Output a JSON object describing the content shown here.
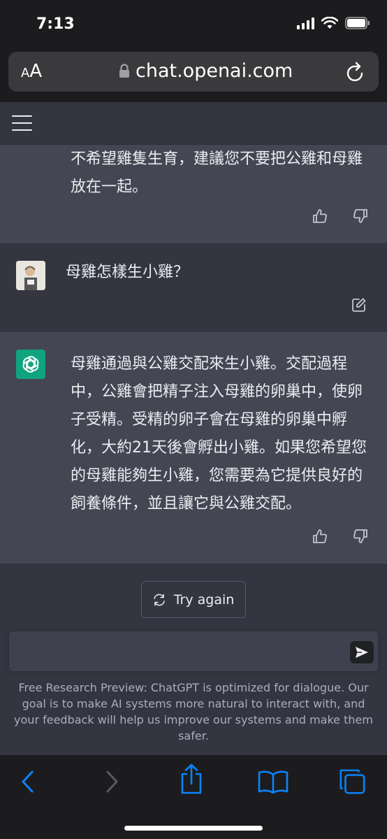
{
  "status_bar": {
    "time": "7:13"
  },
  "browser": {
    "aa_small": "A",
    "aa_large": "A",
    "url": "chat.openai.com"
  },
  "messages": {
    "prev_answer_tail": "不希望雞隻生育，建議您不要把公雞和母雞放在一起。",
    "user_question": "母雞怎樣生小雞？",
    "answer": "母雞通過與公雞交配來生小雞。交配過程中，公雞會把精子注入母雞的卵巢中，使卵子受精。受精的卵子會在母雞的卵巢中孵化，大約21天後會孵出小雞。如果您希望您的母雞能夠生小雞，您需要為它提供良好的飼養條件，並且讓它與公雞交配。"
  },
  "actions": {
    "try_again": "Try again"
  },
  "composer": {
    "placeholder": ""
  },
  "disclaimer": "Free Research Preview: ChatGPT is optimized for dialogue. Our goal is to make AI systems more natural to interact with, and your feedback will help us improve our systems and make them safer.",
  "icons": {
    "lock": "lock-icon",
    "reload": "reload-icon",
    "menu": "menu-icon",
    "thumbs_up": "thumbs-up-icon",
    "thumbs_down": "thumbs-down-icon",
    "edit": "edit-icon",
    "refresh": "refresh-icon",
    "send": "send-icon",
    "back": "back-icon",
    "forward": "forward-icon",
    "share": "share-icon",
    "bookmarks": "bookmarks-icon",
    "tabs": "tabs-icon"
  },
  "colors": {
    "assistant_bg": "#444654",
    "user_bg": "#343541",
    "gpt_green": "#10a37f",
    "ios_blue": "#0a84ff",
    "text": "#ececf1",
    "muted": "#acacbe"
  }
}
